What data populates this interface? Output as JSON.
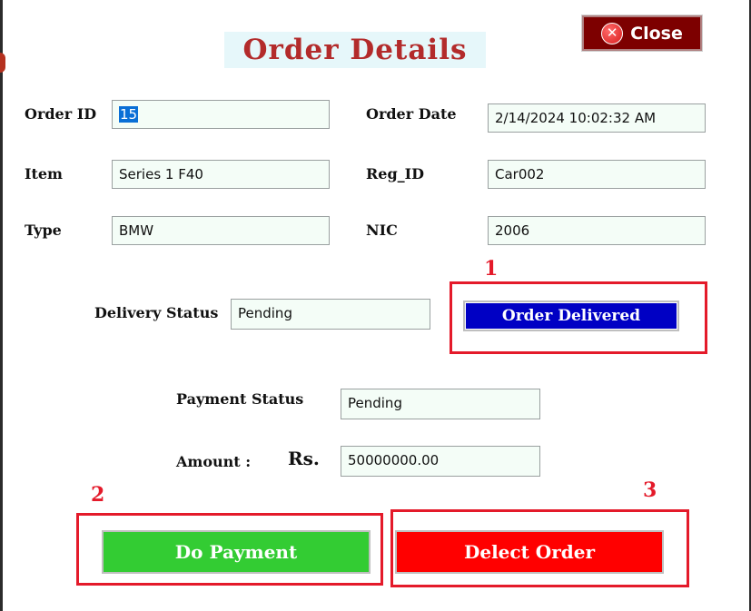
{
  "window": {
    "title": "Order Details",
    "close_label": "Close"
  },
  "fields": {
    "order_id": {
      "label": "Order ID",
      "value": "15"
    },
    "order_date": {
      "label": "Order Date",
      "value": "2/14/2024 10:02:32 AM"
    },
    "item": {
      "label": "Item",
      "value": "Series 1 F40"
    },
    "reg_id": {
      "label": "Reg_ID",
      "value": "Car002"
    },
    "type": {
      "label": "Type",
      "value": "BMW"
    },
    "nic": {
      "label": "NIC",
      "value": "2006"
    },
    "delivery_status": {
      "label": "Delivery Status",
      "value": "Pending"
    },
    "payment_status": {
      "label": "Payment Status",
      "value": "Pending"
    },
    "amount": {
      "label": "Amount :",
      "currency": "Rs.",
      "value": "50000000.00"
    }
  },
  "buttons": {
    "order_delivered": "Order Delivered",
    "do_payment": "Do Payment",
    "delete_order": "Delect Order"
  },
  "annotations": {
    "marker_1": "1",
    "marker_2": "2",
    "marker_3": "3"
  },
  "colors": {
    "title": "#b32b2b",
    "close_button": "#7d0000",
    "order_delivered_button": "#0000c4",
    "do_payment_button": "#33cc33",
    "delete_order_button": "#ff0000",
    "annotation_red": "#e41a2a",
    "field_background": "#f4fdf7"
  },
  "icons": {
    "close": "close-circle-icon"
  }
}
